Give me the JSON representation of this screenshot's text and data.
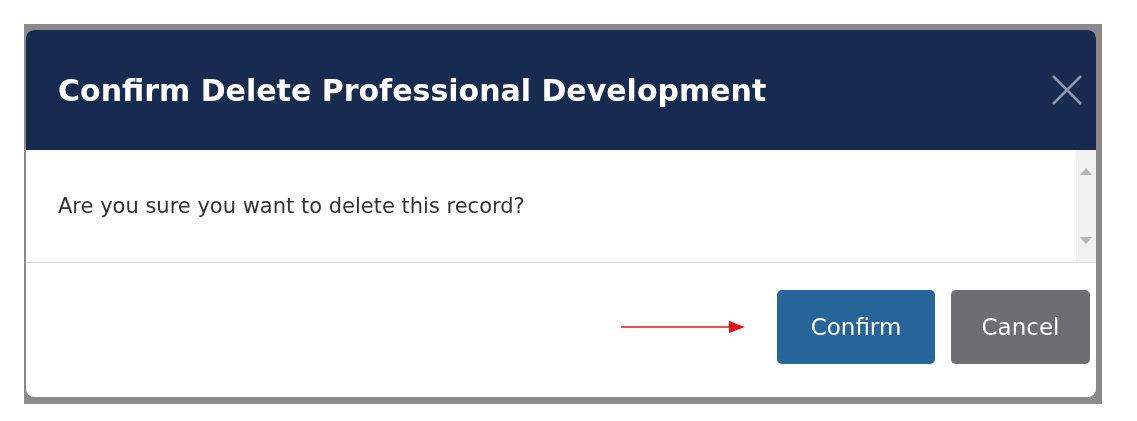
{
  "dialog": {
    "title": "Confirm Delete Professional Development",
    "message": "Are you sure you want to delete this record?",
    "buttons": [
      {
        "label": "Confirm",
        "kind": "primary"
      },
      {
        "label": "Cancel",
        "kind": "secondary"
      }
    ]
  }
}
